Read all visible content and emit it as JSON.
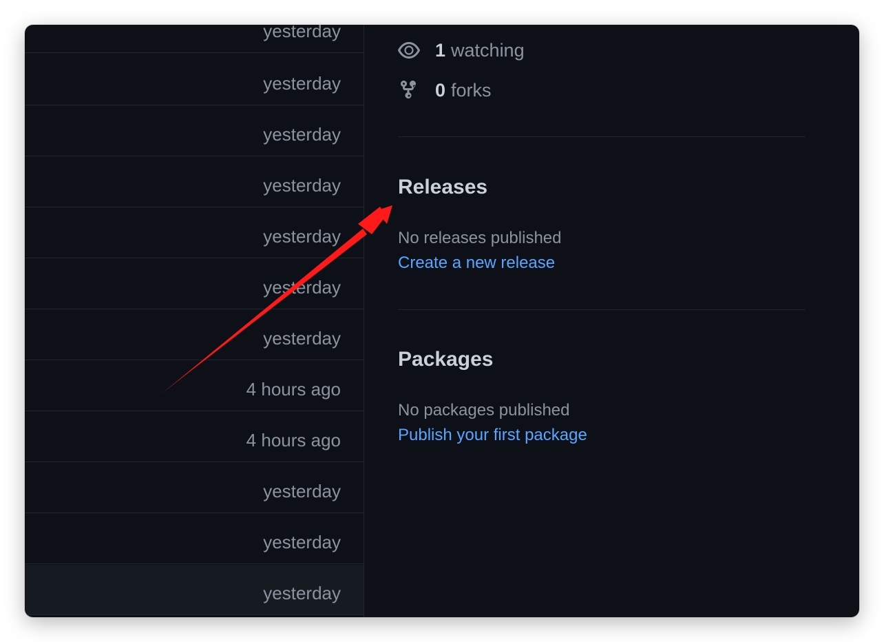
{
  "commit_times": [
    "yesterday",
    "yesterday",
    "yesterday",
    "yesterday",
    "yesterday",
    "yesterday",
    "yesterday",
    "4 hours ago",
    "4 hours ago",
    "yesterday",
    "yesterday",
    "yesterday"
  ],
  "sidebar": {
    "watching": {
      "count": "1",
      "label": "watching",
      "icon": "eye-icon"
    },
    "forks": {
      "count": "0",
      "label": "forks",
      "icon": "fork-icon"
    },
    "releases": {
      "title": "Releases",
      "empty_text": "No releases published",
      "link": "Create a new release"
    },
    "packages": {
      "title": "Packages",
      "empty_text": "No packages published",
      "link": "Publish your first package"
    }
  },
  "colors": {
    "background": "#0d1117",
    "muted_text": "#8b949e",
    "heading_text": "#c9d1d9",
    "link": "#58a6ff",
    "annotation_arrow": "#ff1a1a"
  }
}
